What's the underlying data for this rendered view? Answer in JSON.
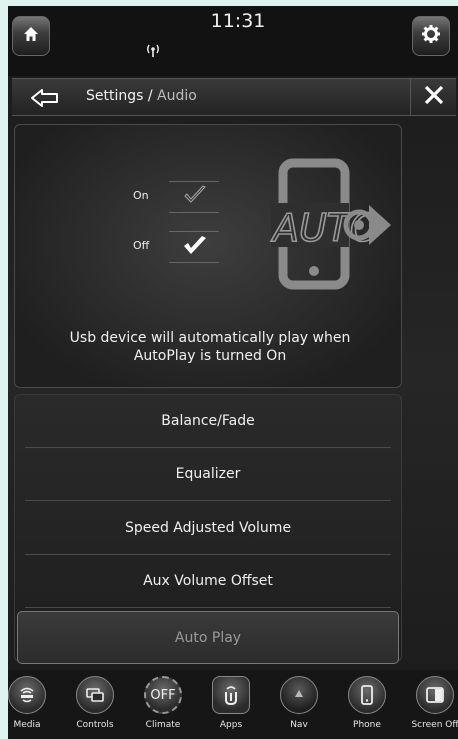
{
  "status": {
    "time": "11:31",
    "home_icon": "home-icon",
    "settings_icon": "gear-icon",
    "signal_icon": "wireless-signal-icon"
  },
  "titlebar": {
    "crumb_parent": "Settings",
    "crumb_separator": " / ",
    "crumb_current": "Audio",
    "back_icon": "back-arrow-icon",
    "close_icon": "close-icon"
  },
  "autoplay_panel": {
    "on_label": "On",
    "off_label": "Off",
    "selected": "Off",
    "graphic_text": "AUTO",
    "description_line1": "Usb device will automatically play when",
    "description_line2": "AutoPlay is turned On"
  },
  "menu": {
    "items": [
      {
        "label": "Balance/Fade"
      },
      {
        "label": "Equalizer"
      },
      {
        "label": "Speed Adjusted Volume"
      },
      {
        "label": "Aux Volume Offset"
      },
      {
        "label": "Auto Play"
      }
    ],
    "active": "Auto Play"
  },
  "dock": {
    "items": [
      {
        "label": "Media",
        "icon": "media-icon"
      },
      {
        "label": "Controls",
        "icon": "controls-icon"
      },
      {
        "label": "Climate",
        "icon": "climate-off-icon",
        "text": "OFF"
      },
      {
        "label": "Apps",
        "icon": "apps-icon"
      },
      {
        "label": "Nav",
        "icon": "nav-icon"
      },
      {
        "label": "Phone",
        "icon": "phone-icon"
      },
      {
        "label": "Screen Off",
        "icon": "screen-off-icon"
      }
    ]
  }
}
